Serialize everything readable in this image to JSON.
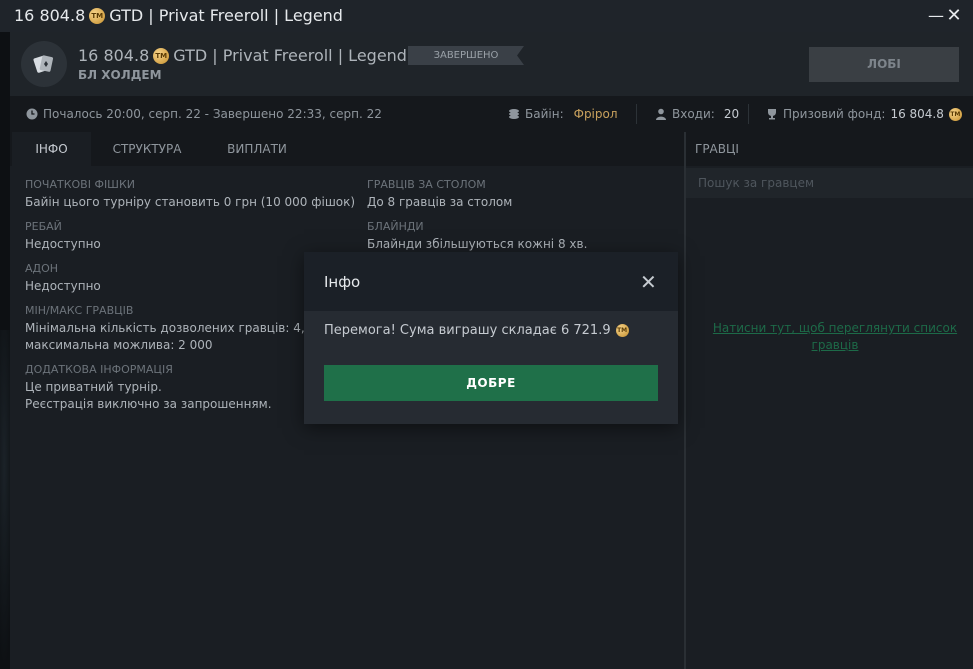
{
  "window": {
    "title_amount": "16 804.8",
    "title_rest": "GTD | Privat Freeroll | Legend",
    "minimize": "—",
    "close": "✕"
  },
  "coin_label": "TM",
  "header": {
    "amount": "16 804.8",
    "rest": "GTD | Privat Freeroll | Legend",
    "status": "ЗАВЕРШЕНО",
    "game_type": "БЛ ХОЛДЕМ",
    "lobby_button": "ЛОБІ"
  },
  "info_strip": {
    "schedule": "Почалось 20:00, серп. 22  -  Завершено 22:33, серп. 22",
    "buyin_label": "Байін:",
    "buyin_value": "Фрірол",
    "entries_label": "Входи:",
    "entries_value": "20",
    "prize_label": "Призовий фонд:",
    "prize_value": "16 804.8"
  },
  "tabs": [
    {
      "label": "ІНФО",
      "active": true
    },
    {
      "label": "СТРУКТУРА",
      "active": false
    },
    {
      "label": "ВИПЛАТИ",
      "active": false
    }
  ],
  "info": {
    "starting_chips": {
      "label": "ПОЧАТКОВІ ФІШКИ",
      "value": "Байін цього турніру становить 0 грн (10 000 фішок)"
    },
    "players_per_table": {
      "label": "ГРАВЦІВ ЗА СТОЛОМ",
      "value": "До 8 гравців за столом"
    },
    "rebuy": {
      "label": "РЕБАЙ",
      "value": "Недоступно"
    },
    "blinds": {
      "label": "БЛАЙНДИ",
      "value": "Блайнди збільшуються кожні 8 хв."
    },
    "addon": {
      "label": "АДОН",
      "value": "Недоступно"
    },
    "min_max": {
      "label": "МІН/МАКС ГРАВЦІВ",
      "value_line1": "Мінімальна кількість дозволених гравців: 4,",
      "value_line2": "максимальна можлива: 2 000"
    },
    "extra": {
      "label": "ДОДАТКОВА ІНФОРМАЦІЯ",
      "value_line1": "Це приватний турнір.",
      "value_line2": "Реєстрація виключно за запрошенням."
    }
  },
  "players_panel": {
    "heading": "ГРАВЦІ",
    "search_placeholder": "Пошук за гравцем",
    "link_line1": "Натисни тут, щоб переглянути список",
    "link_line2": "гравців"
  },
  "modal": {
    "title": "Інфо",
    "close": "✕",
    "message": "Перемога! Сума виграшу складає 6 721.9",
    "ok_button": "ДОБРЕ"
  }
}
